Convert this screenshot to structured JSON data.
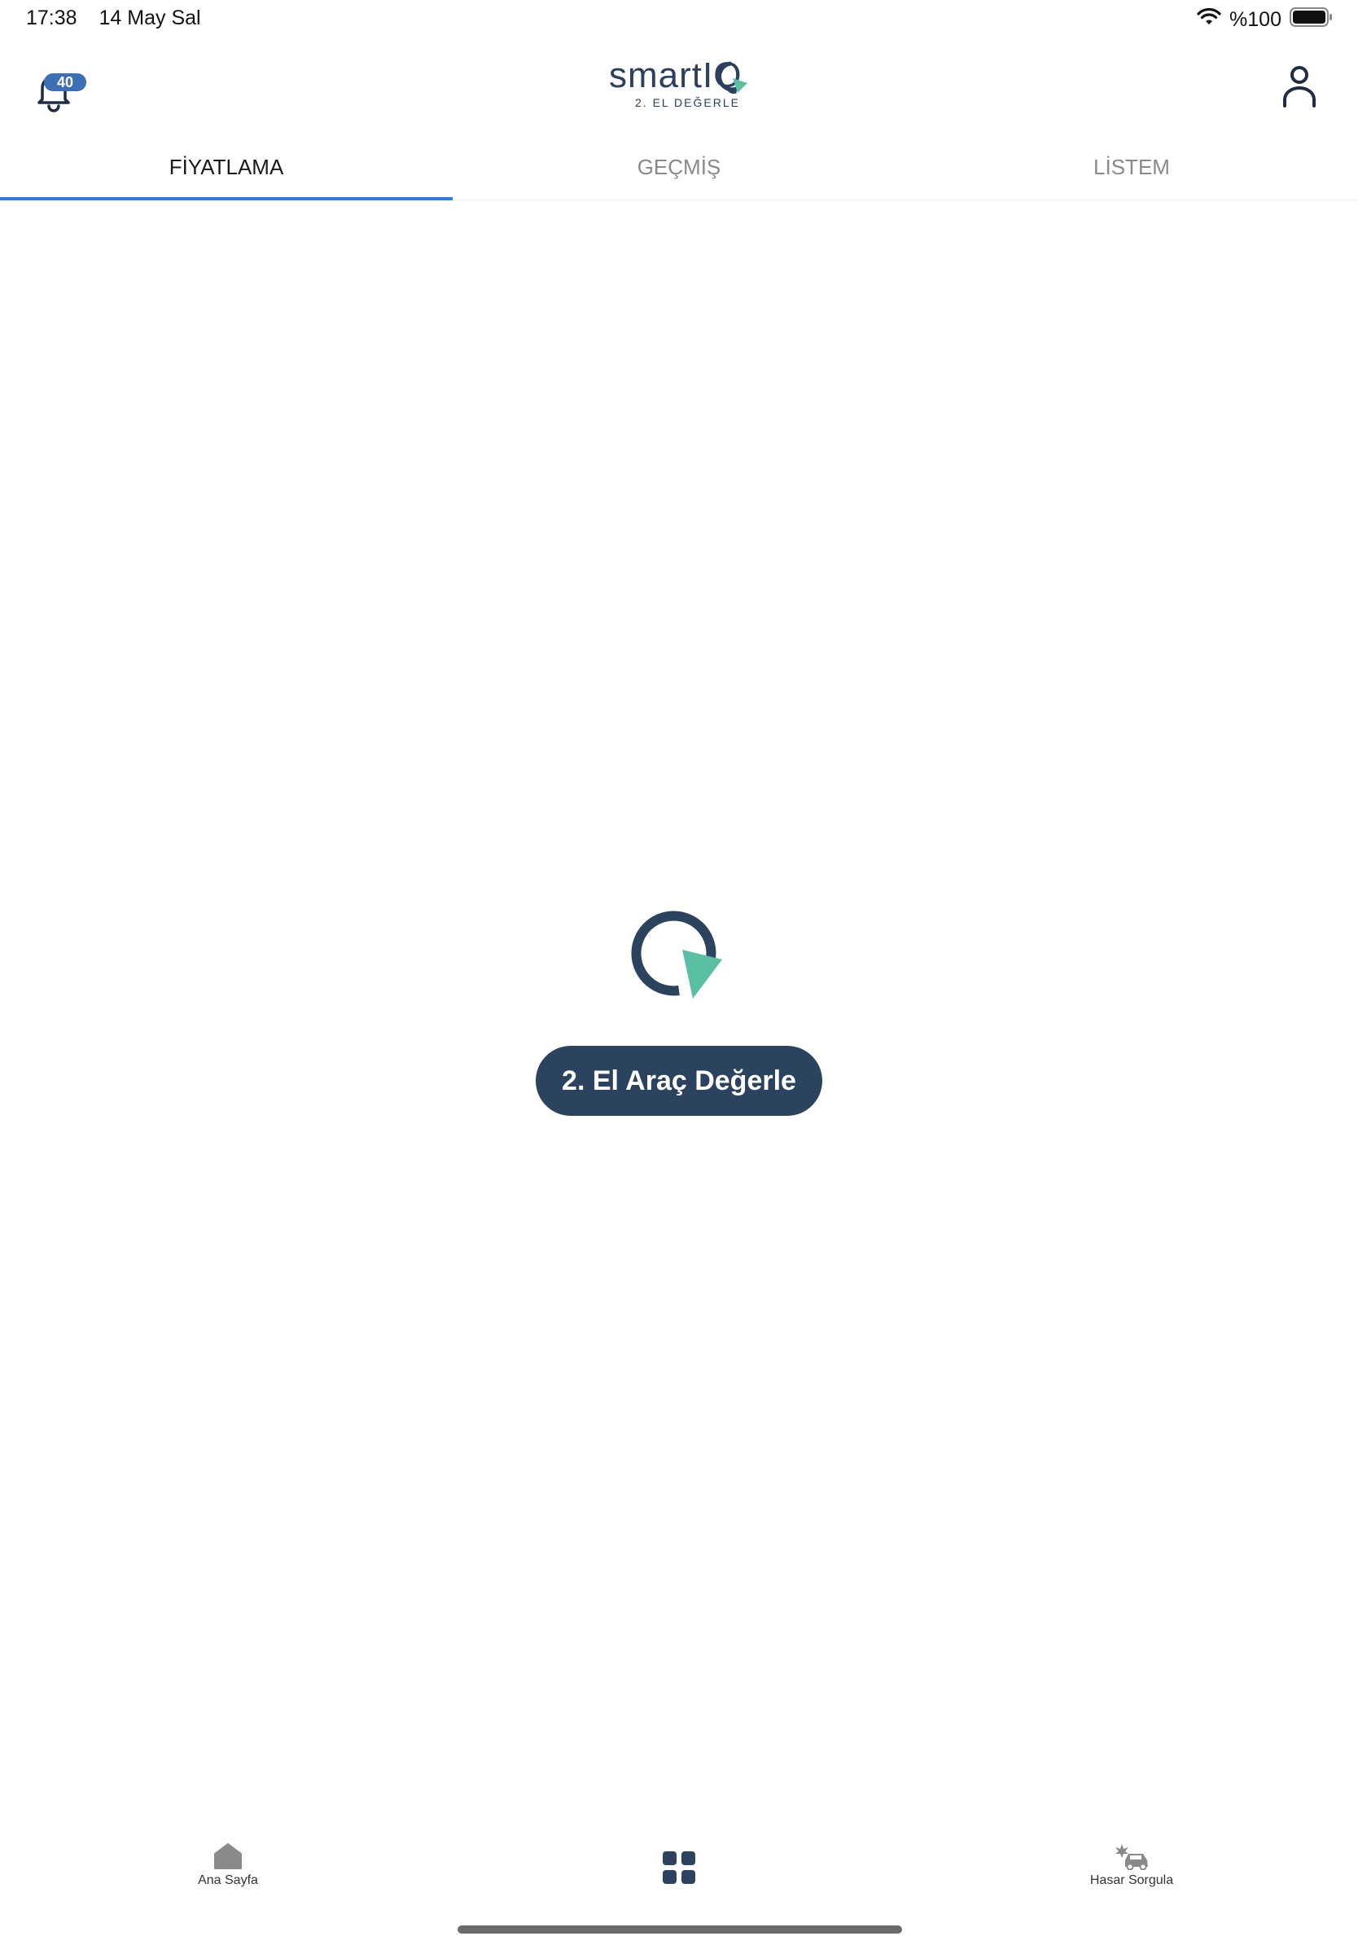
{
  "status_bar": {
    "time": "17:38",
    "date": "14 May Sal",
    "battery": "%100"
  },
  "header": {
    "notification_count": "40",
    "logo_text": "smartIQ",
    "logo_subtitle": "2. EL DEĞERLE"
  },
  "tabs": [
    {
      "label": "FİYATLAMA",
      "active": true
    },
    {
      "label": "GEÇMİŞ",
      "active": false
    },
    {
      "label": "LİSTEM",
      "active": false
    }
  ],
  "main": {
    "cta_label": "2. El Araç Değerle"
  },
  "bottom_nav": [
    {
      "label": "Ana Sayfa",
      "icon": "home-icon"
    },
    {
      "label": "",
      "icon": "grid-icon"
    },
    {
      "label": "Hasar Sorgula",
      "icon": "car-damage-icon"
    }
  ],
  "colors": {
    "brand_navy": "#2c4360",
    "brand_teal": "#5bbfa3",
    "tab_indicator": "#2f7de1",
    "badge": "#3d6fb4"
  }
}
